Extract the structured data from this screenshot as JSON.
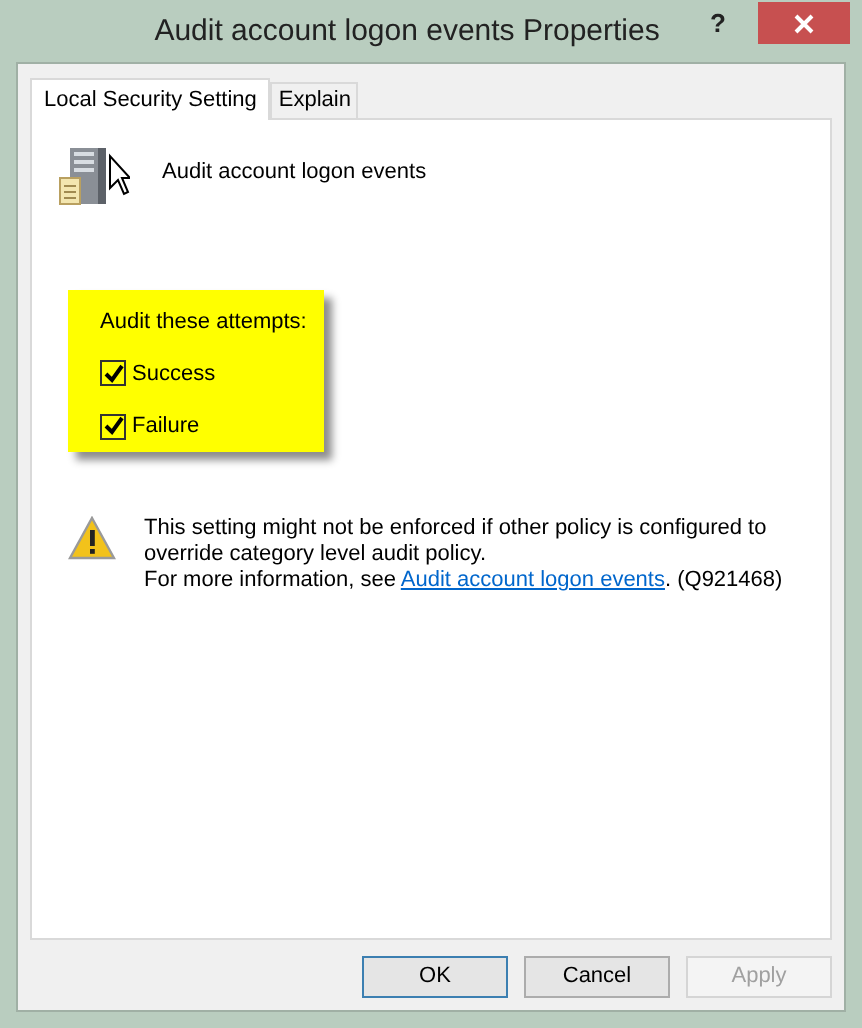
{
  "window": {
    "title": "Audit account logon events Properties",
    "help": "?"
  },
  "tabs": [
    {
      "label": "Local Security Setting",
      "selected": true
    },
    {
      "label": "Explain",
      "selected": false
    }
  ],
  "policy_name": "Audit account logon events",
  "audit_group": {
    "label": "Audit these attempts:",
    "options": [
      {
        "label": "Success",
        "checked": true
      },
      {
        "label": "Failure",
        "checked": true
      }
    ]
  },
  "warning": {
    "text": "This setting might not be enforced if other policy is configured to override category level audit policy.",
    "more_prefix": "For more information, see ",
    "link": "Audit account logon events",
    "more_suffix": ". (Q921468)"
  },
  "buttons": [
    {
      "label": "OK",
      "default": true,
      "disabled": false
    },
    {
      "label": "Cancel",
      "default": false,
      "disabled": false
    },
    {
      "label": "Apply",
      "default": false,
      "disabled": true
    }
  ]
}
